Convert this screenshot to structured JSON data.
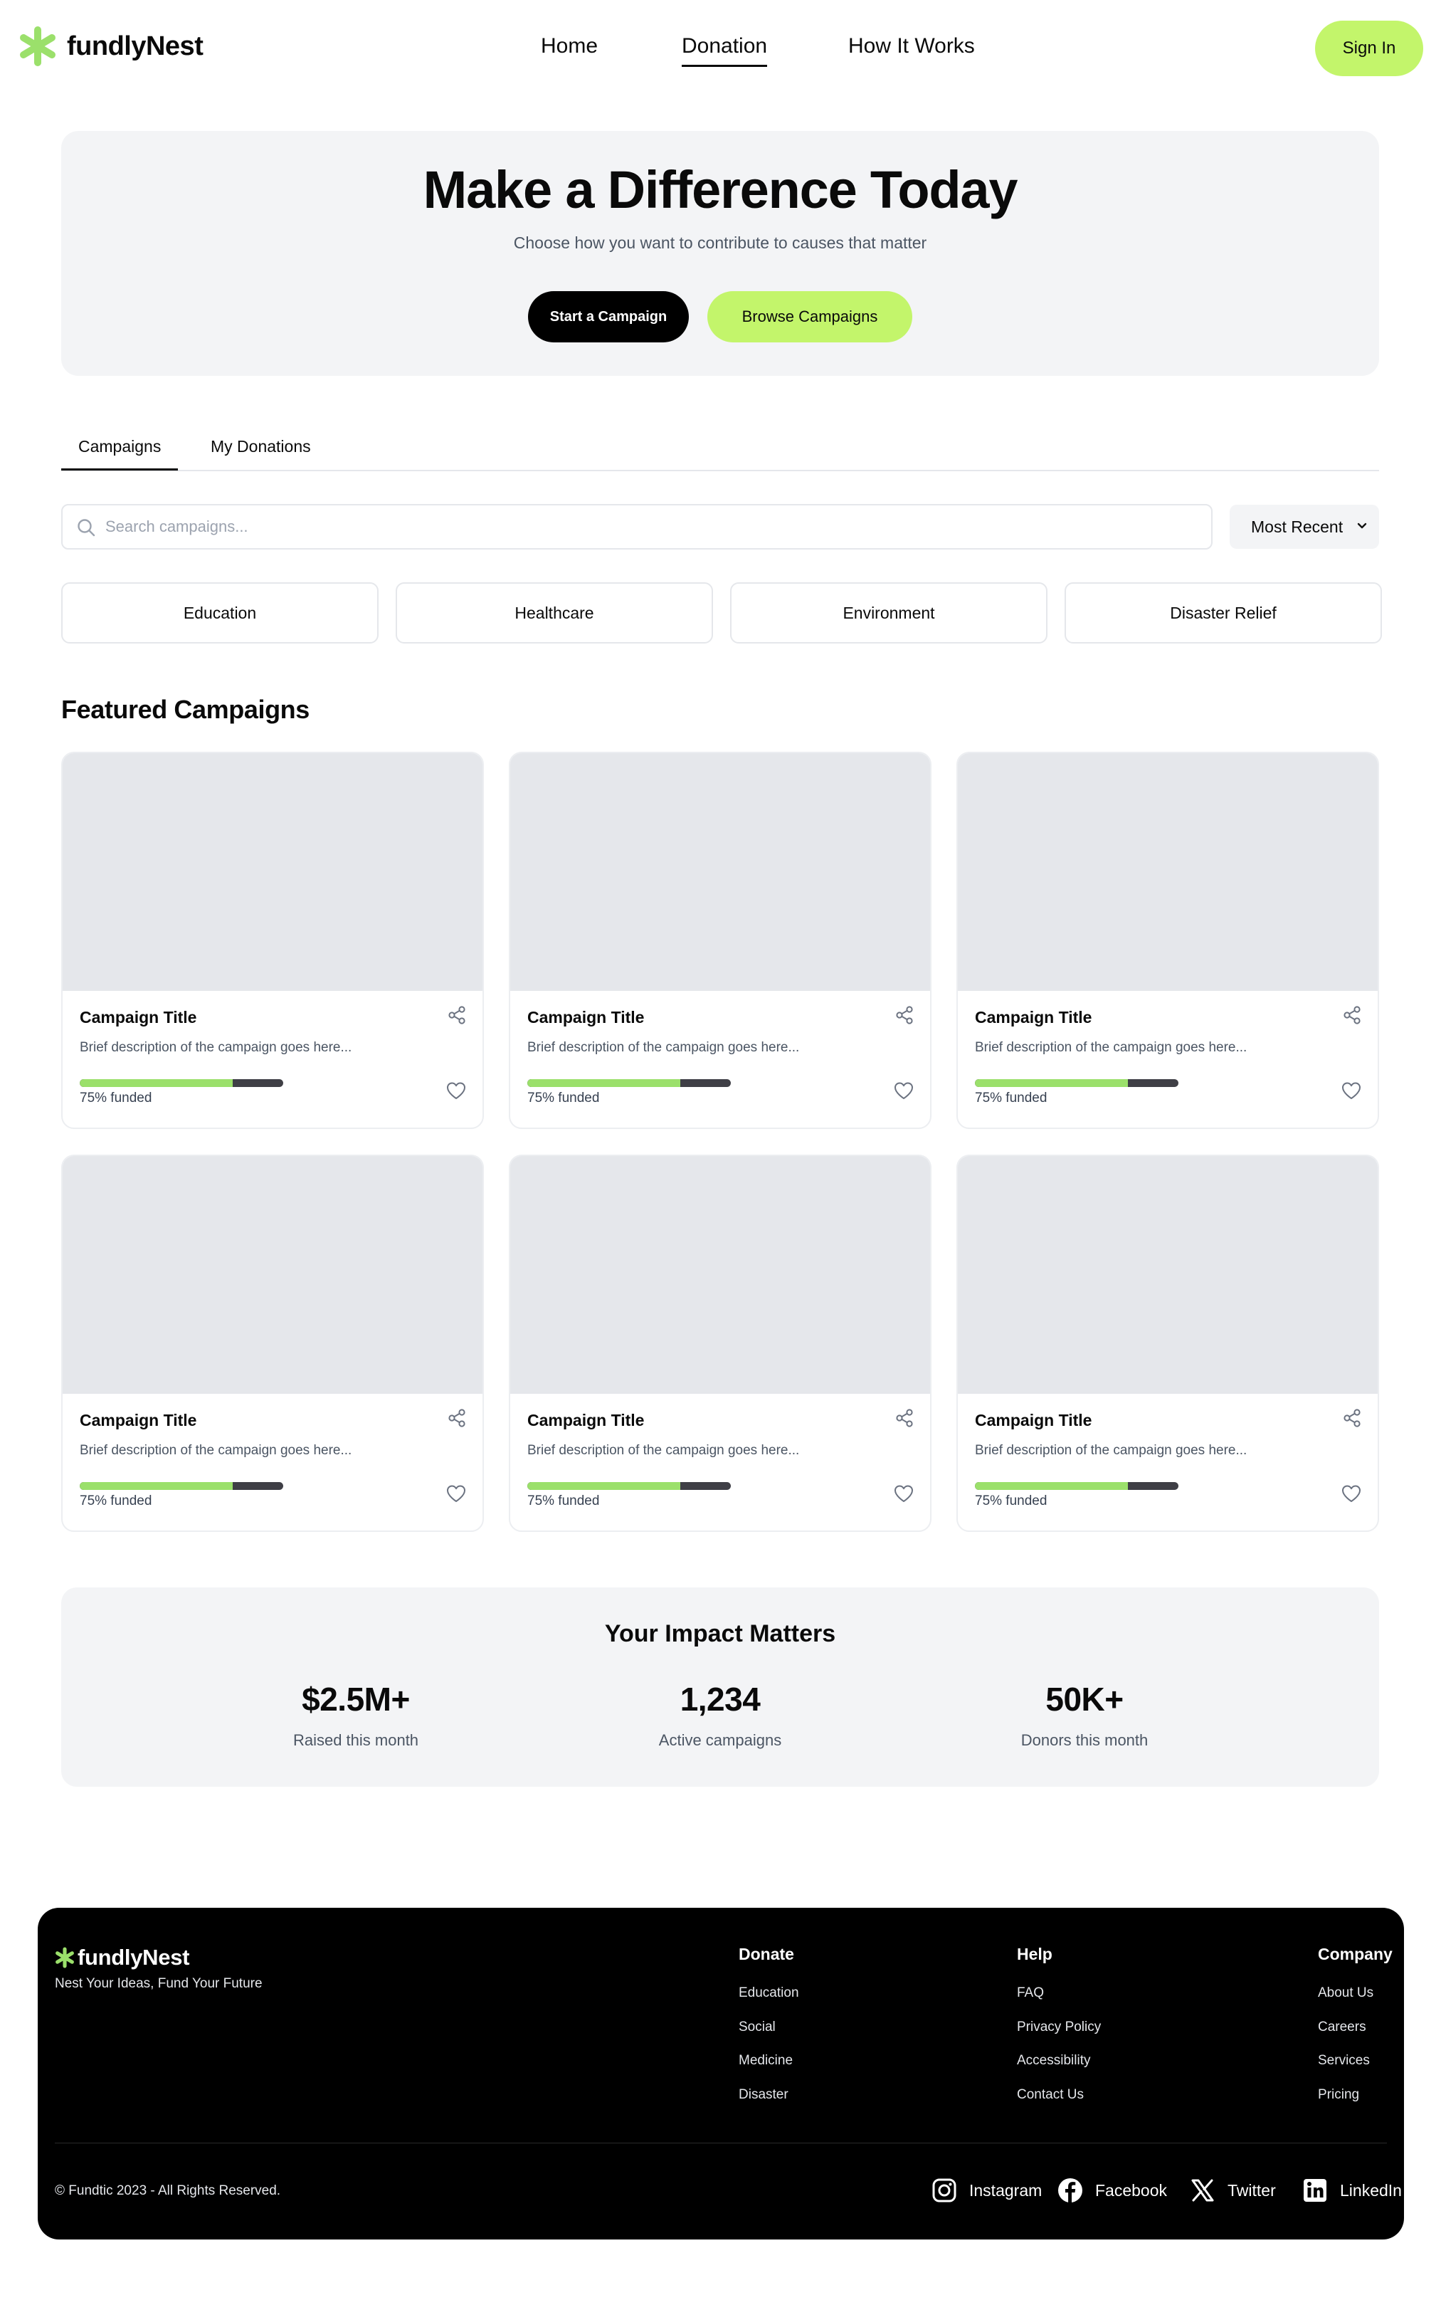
{
  "brand": {
    "name": "fundlyNest",
    "accent": "#c3f56b",
    "logo_icon": "asterisk-icon"
  },
  "nav": {
    "links": [
      "Home",
      "Donation",
      "How It Works"
    ],
    "active": "Donation",
    "signin": "Sign In"
  },
  "hero": {
    "title": "Make a Difference Today",
    "subtitle": "Choose how you want to contribute to causes that matter",
    "primary_button": "Start a Campaign",
    "secondary_button": "Browse Campaigns"
  },
  "tabs": {
    "items": [
      "Campaigns",
      "My Donations"
    ],
    "active": "Campaigns"
  },
  "search": {
    "placeholder": "Search campaigns...",
    "value": ""
  },
  "sort": {
    "selected": "Most Recent"
  },
  "categories": [
    "Education",
    "Healthcare",
    "Environment",
    "Disaster Relief"
  ],
  "featured": {
    "title": "Featured Campaigns",
    "cards": [
      {
        "title": "Campaign Title",
        "description": "Brief description of the campaign goes here...",
        "funded_label": "75% funded",
        "progress": 0.75
      },
      {
        "title": "Campaign Title",
        "description": "Brief description of the campaign goes here...",
        "funded_label": "75% funded",
        "progress": 0.75
      },
      {
        "title": "Campaign Title",
        "description": "Brief description of the campaign goes here...",
        "funded_label": "75% funded",
        "progress": 0.75
      },
      {
        "title": "Campaign Title",
        "description": "Brief description of the campaign goes here...",
        "funded_label": "75% funded",
        "progress": 0.75
      },
      {
        "title": "Campaign Title",
        "description": "Brief description of the campaign goes here...",
        "funded_label": "75% funded",
        "progress": 0.75
      },
      {
        "title": "Campaign Title",
        "description": "Brief description of the campaign goes here...",
        "funded_label": "75% funded",
        "progress": 0.75
      }
    ]
  },
  "impact": {
    "title": "Your Impact Matters",
    "stats": [
      {
        "value": "$2.5M+",
        "label": "Raised this month"
      },
      {
        "value": "1,234",
        "label": "Active campaigns"
      },
      {
        "value": "50K+",
        "label": "Donors this month"
      }
    ]
  },
  "footer": {
    "brand": "fundlyNest",
    "tagline": "Nest Your Ideas, Fund Your Future",
    "columns": [
      {
        "heading": "Donate",
        "links": [
          "Education",
          "Social",
          "Medicine",
          "Disaster"
        ]
      },
      {
        "heading": "Help",
        "links": [
          "FAQ",
          "Privacy Policy",
          "Accessibility",
          "Contact Us"
        ]
      },
      {
        "heading": "Company",
        "links": [
          "About Us",
          "Careers",
          "Services",
          "Pricing"
        ]
      }
    ],
    "copyright": "© Fundtic 2023 - All Rights Reserved.",
    "social": [
      {
        "label": "Instagram",
        "icon": "instagram-icon"
      },
      {
        "label": "Facebook",
        "icon": "facebook-icon"
      },
      {
        "label": "Twitter",
        "icon": "x-twitter-icon"
      },
      {
        "label": "LinkedIn",
        "icon": "linkedin-icon"
      }
    ]
  }
}
